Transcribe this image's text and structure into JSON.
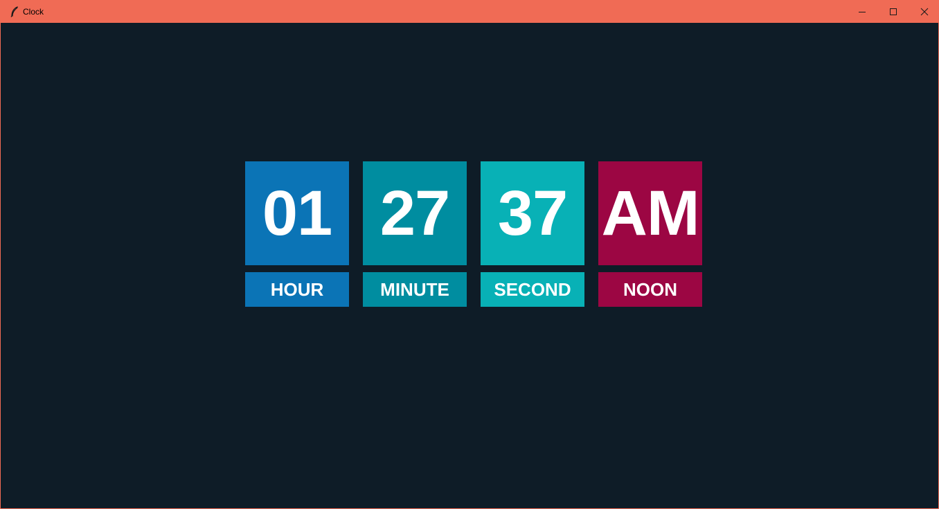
{
  "window": {
    "title": "Clock",
    "controls": {
      "minimize_icon": "minimize-icon",
      "maximize_icon": "maximize-icon",
      "close_icon": "close-icon"
    },
    "title_bar_color": "#f06b55",
    "background_color": "#0e1c27"
  },
  "clock": {
    "hour": {
      "value": "01",
      "label": "HOUR",
      "color": "#0b74b6"
    },
    "minute": {
      "value": "27",
      "label": "MINUTE",
      "color": "#008da0"
    },
    "second": {
      "value": "37",
      "label": "SECOND",
      "color": "#08b1b6"
    },
    "noon": {
      "value": "AM",
      "label": "NOON",
      "color": "#9c0643"
    }
  }
}
